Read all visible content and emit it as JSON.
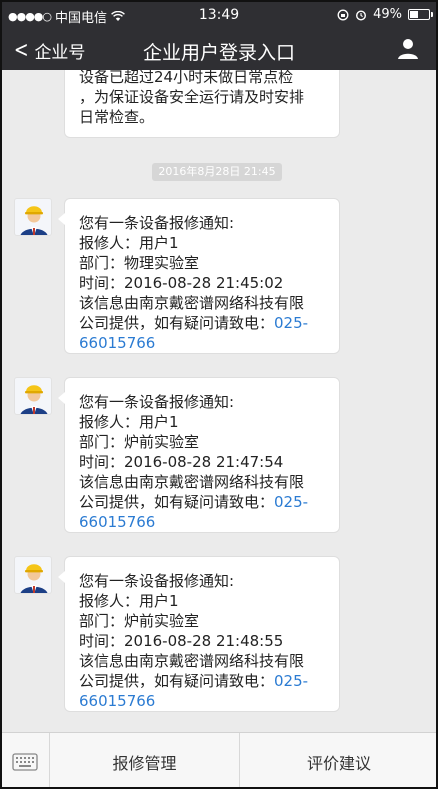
{
  "status_bar": {
    "signal": "●●●●○",
    "carrier": "中国电信",
    "time": "13:49",
    "battery_text": "49%",
    "battery_level": 0.49
  },
  "nav": {
    "back_label": "企业号",
    "title": "企业用户登录入口",
    "user_icon": "user-icon"
  },
  "top_message": {
    "lines": [
      "设备已超过24小时未做日常点检",
      "，为保证设备安全运行请及时安排",
      "日常检查。"
    ]
  },
  "time_divider": "2016年8月28日 21:45",
  "messages": [
    {
      "line1": "您有一条设备报修通知:",
      "line2": "报修人：用户1",
      "line3": "部门：物理实验室",
      "line4": "时间：2016-08-28 21:45:02",
      "line5": "该信息由南京戴密谱网络科技有限",
      "line6_prefix": "公司提供，如有疑问请致电：",
      "phone_a": "025-",
      "phone_b": "66015766"
    },
    {
      "line1": "您有一条设备报修通知:",
      "line2": "报修人：用户1",
      "line3": "部门：炉前实验室",
      "line4": "时间：2016-08-28 21:47:54",
      "line5": "该信息由南京戴密谱网络科技有限",
      "line6_prefix": "公司提供，如有疑问请致电：",
      "phone_a": "025-",
      "phone_b": "66015766"
    },
    {
      "line1": "您有一条设备报修通知:",
      "line2": "报修人：用户1",
      "line3": "部门：炉前实验室",
      "line4": "时间：2016-08-28 21:48:55",
      "line5": "该信息由南京戴密谱网络科技有限",
      "line6_prefix": "公司提供，如有疑问请致电：",
      "phone_a": "025-",
      "phone_b": "66015766"
    }
  ],
  "bottom_menu": {
    "keyboard_icon": "keyboard-icon",
    "item1": "报修管理",
    "item2": "评价建议"
  },
  "colors": {
    "bar": "#2f2f33",
    "link": "#2b7bd2",
    "background": "#ebebeb"
  }
}
